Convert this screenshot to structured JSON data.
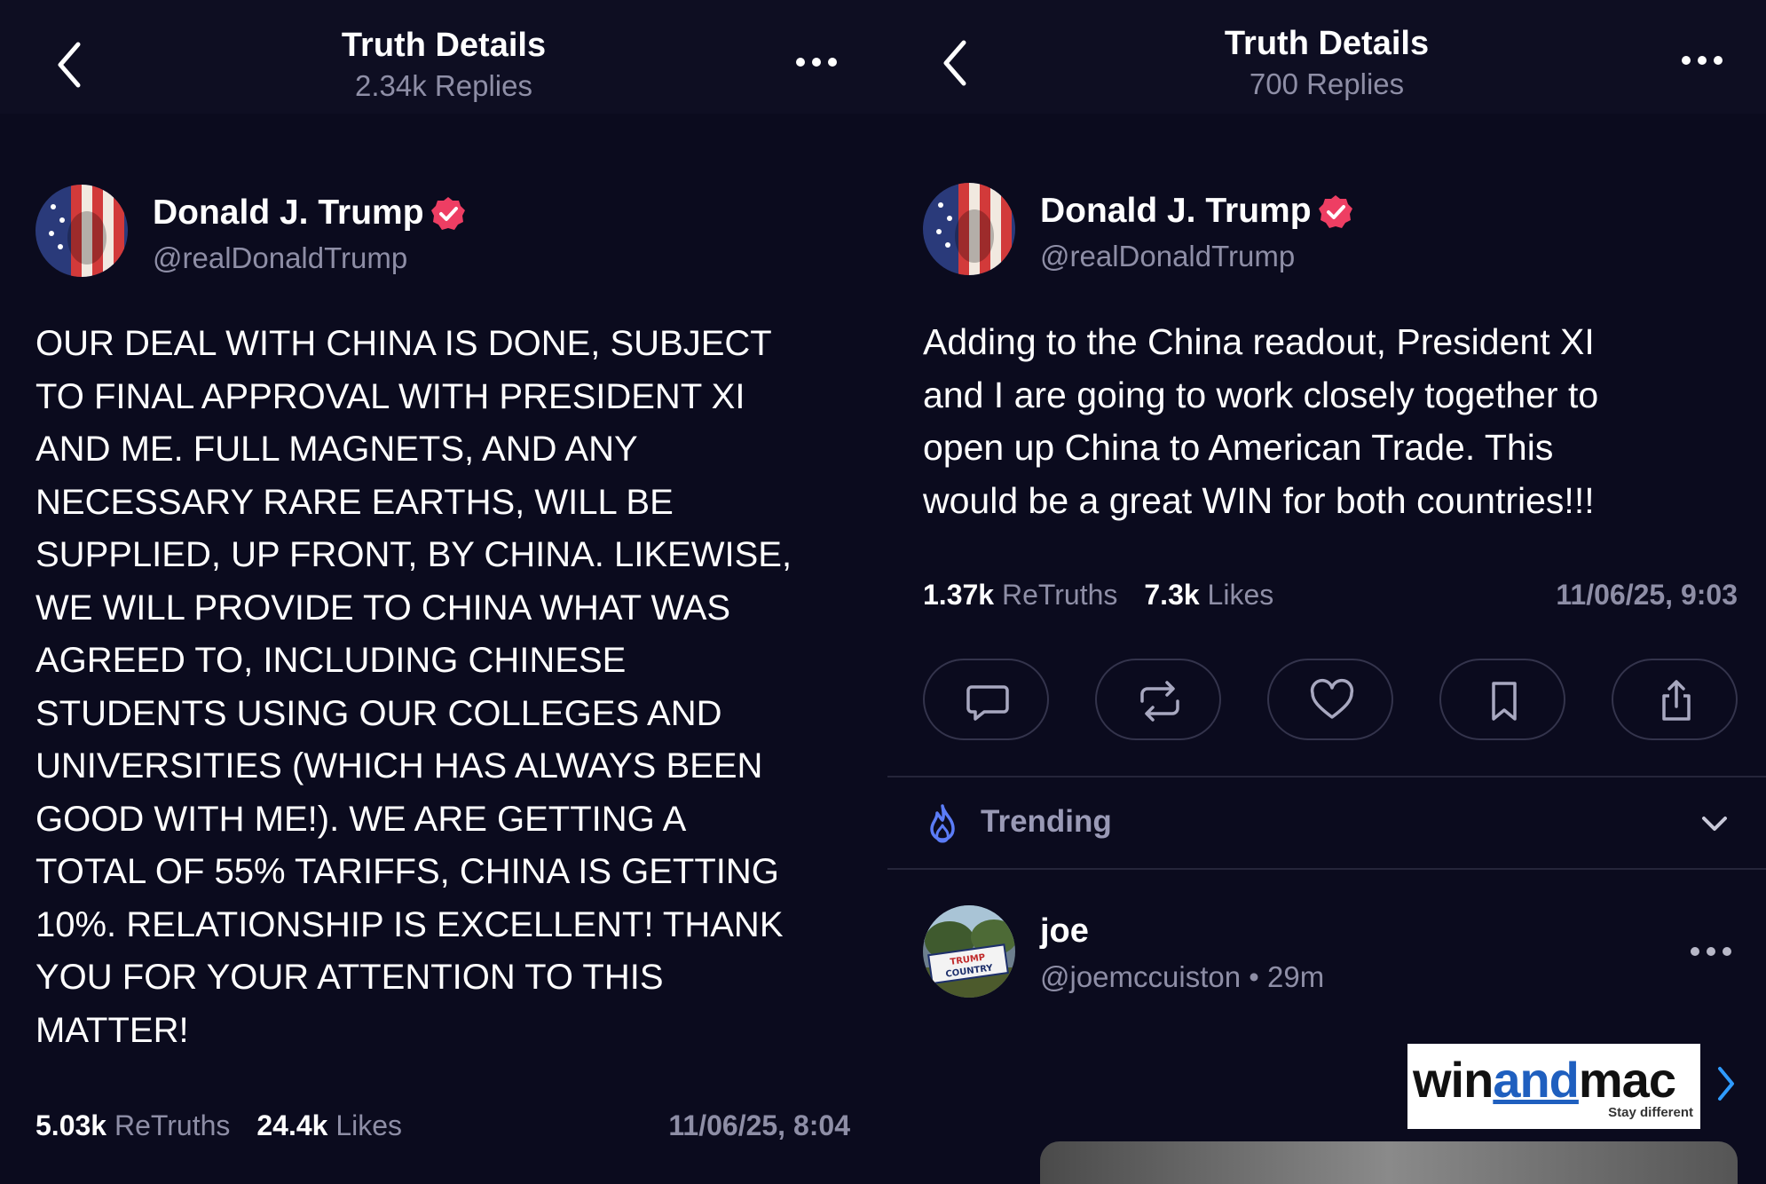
{
  "left": {
    "header": {
      "title": "Truth Details",
      "subtitle": "2.34k Replies"
    },
    "author": {
      "name": "Donald J. Trump",
      "handle": "@realDonaldTrump"
    },
    "post_lines": [
      "OUR DEAL WITH CHINA IS DONE, SUBJECT",
      "TO FINAL APPROVAL WITH PRESIDENT XI",
      "AND ME. FULL MAGNETS, AND ANY",
      "NECESSARY RARE EARTHS, WILL BE",
      "SUPPLIED, UP FRONT, BY CHINA. LIKEWISE,",
      "WE WILL PROVIDE TO CHINA WHAT WAS",
      "AGREED TO, INCLUDING CHINESE",
      "STUDENTS USING OUR COLLEGES AND",
      "UNIVERSITIES (WHICH HAS ALWAYS BEEN",
      "GOOD WITH ME!). WE ARE GETTING A",
      "TOTAL OF 55% TARIFFS, CHINA IS GETTING",
      "10%. RELATIONSHIP IS EXCELLENT! THANK",
      "YOU FOR YOUR ATTENTION TO THIS",
      "MATTER!"
    ],
    "stats": {
      "retruths_count": "5.03k",
      "retruths_label": "ReTruths",
      "likes_count": "24.4k",
      "likes_label": "Likes"
    },
    "timestamp": "11/06/25, 8:04"
  },
  "right": {
    "header": {
      "title": "Truth Details",
      "subtitle": "700 Replies"
    },
    "author": {
      "name": "Donald J. Trump",
      "handle": "@realDonaldTrump"
    },
    "post_lines": [
      "Adding to the China readout, President XI",
      "and I are going to work closely together to",
      "open up China to American Trade. This",
      "would be a great WIN for both countries!!!"
    ],
    "stats": {
      "retruths_count": "1.37k",
      "retruths_label": "ReTruths",
      "likes_count": "7.3k",
      "likes_label": "Likes"
    },
    "timestamp": "11/06/25, 9:03",
    "actions": [
      "reply-icon",
      "retruth-icon",
      "heart-icon",
      "bookmark-icon",
      "share-icon"
    ],
    "trending": {
      "label": "Trending"
    },
    "reply": {
      "name": "joe",
      "handle": "@joemccuiston",
      "separator": "•",
      "age": "29m",
      "avatar_sign_text": "TRUMP COUNTRY"
    },
    "ad": {
      "brand_prefix": "win",
      "brand_accent": "and",
      "brand_suffix": "mac",
      "tagline": "Stay different"
    }
  },
  "colors": {
    "background": "#0b0b1e",
    "header_bg": "#0e0e22",
    "muted_text": "#8e8ea6",
    "verified_badge": "#ee3e63",
    "trending_icon": "#5b7cf7",
    "ad_accent": "#1f5fbf",
    "chevron_accent": "#2f9bff"
  }
}
